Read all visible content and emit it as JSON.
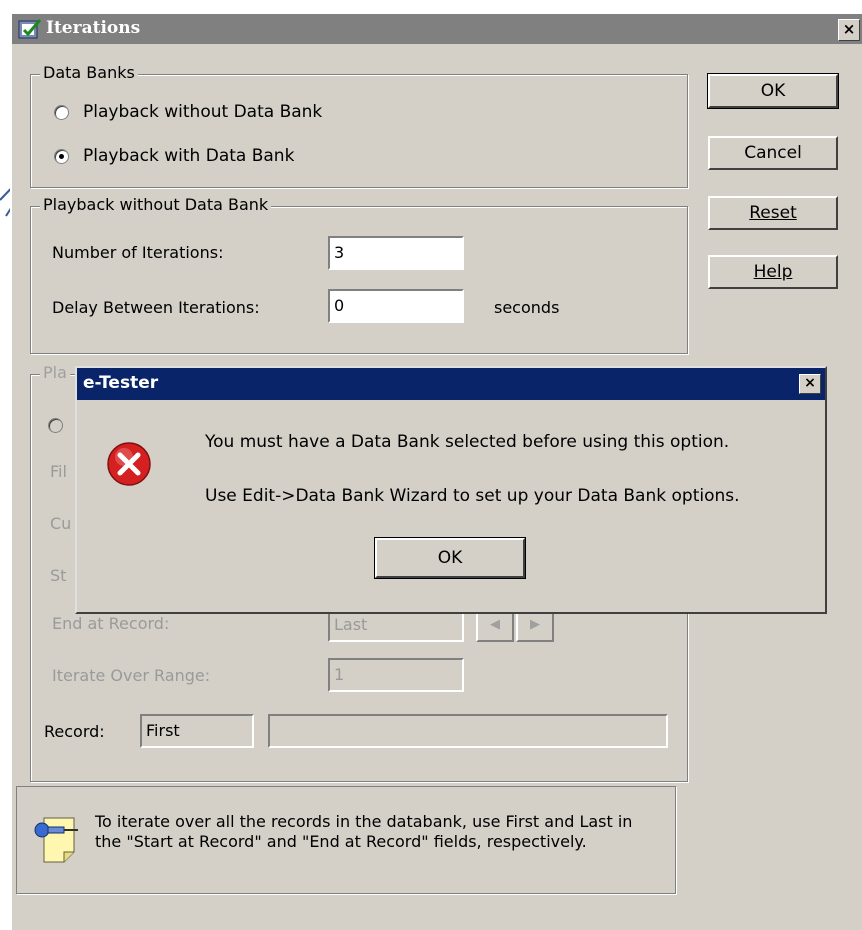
{
  "window": {
    "title": "Iterations",
    "close_glyph": "×"
  },
  "data_banks": {
    "legend": "Data Banks",
    "options": [
      {
        "label": "Playback without Data Bank",
        "selected": false
      },
      {
        "label": "Playback with Data Bank",
        "selected": true
      }
    ]
  },
  "without_bank": {
    "legend": "Playback without Data Bank",
    "iterations_label": "Number of Iterations:",
    "iterations_value": "3",
    "delay_label": "Delay Between Iterations:",
    "delay_value": "0",
    "delay_unit": "seconds"
  },
  "with_bank": {
    "legend_partial": "Pla",
    "row_fragments": [
      "Fil",
      "Cu",
      "St"
    ],
    "end_label": "End at Record:",
    "end_value": "Last",
    "range_label": "Iterate Over Range:",
    "range_value": "1",
    "record_label": "Record:",
    "record_value": "First",
    "record_detail": ""
  },
  "buttons": {
    "ok": "OK",
    "cancel": "Cancel",
    "reset": "Reset",
    "help": "Help"
  },
  "hint": {
    "text": "To iterate over all the records in the databank, use First and Last in the \"Start at Record\" and \"End at Record\" fields, respectively."
  },
  "dialog": {
    "title": "e-Tester",
    "close_glyph": "×",
    "line1": "You must have a Data Bank selected before using this option.",
    "line2": "Use Edit->Data Bank Wizard to set up your Data Bank options.",
    "ok_label": "OK"
  },
  "colors": {
    "dialog_titlebar": "#0a246a",
    "error_icon": "#d42020",
    "window_face": "#d4d0c8"
  }
}
